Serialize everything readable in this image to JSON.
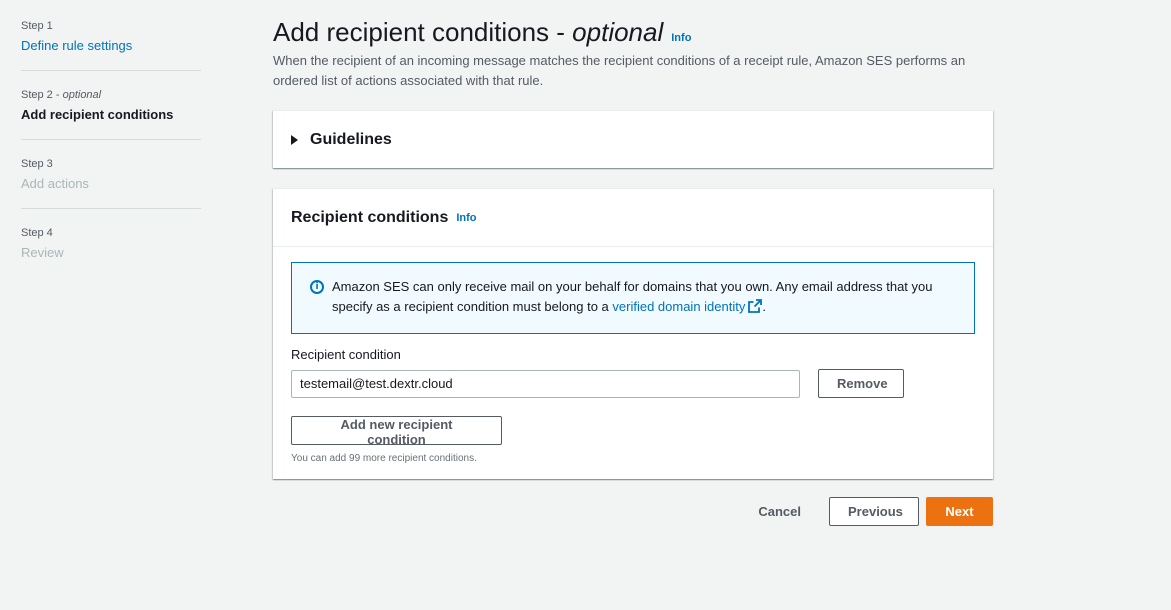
{
  "steps": [
    {
      "num": "Step 1",
      "num_suffix": "",
      "title": "Define rule settings"
    },
    {
      "num": "Step 2 - ",
      "num_suffix": "optional",
      "title": "Add recipient conditions"
    },
    {
      "num": "Step 3",
      "num_suffix": "",
      "title": "Add actions"
    },
    {
      "num": "Step 4",
      "num_suffix": "",
      "title": "Review"
    }
  ],
  "header": {
    "title": "Add recipient conditions - ",
    "title_optional": "optional",
    "info": "Info",
    "description": "When the recipient of an incoming message matches the recipient conditions of a receipt rule, Amazon SES performs an ordered list of actions associated with that rule."
  },
  "guidelines": {
    "title": "Guidelines"
  },
  "conditions": {
    "title": "Recipient conditions",
    "info": "Info",
    "alert": {
      "text": "Amazon SES can only receive mail on your behalf for domains that you own. Any email address that you specify as a recipient condition must belong to a ",
      "link": "verified domain identity",
      "suffix": "."
    },
    "field_label": "Recipient condition",
    "field_value": "testemail@test.dextr.cloud",
    "remove_label": "Remove",
    "add_label": "Add new recipient condition",
    "hint": "You can add 99 more recipient conditions."
  },
  "actions": {
    "cancel": "Cancel",
    "previous": "Previous",
    "next": "Next"
  },
  "colors": {
    "accent": "#ec7211",
    "link": "#0073bb",
    "background": "#f2f3f3"
  }
}
